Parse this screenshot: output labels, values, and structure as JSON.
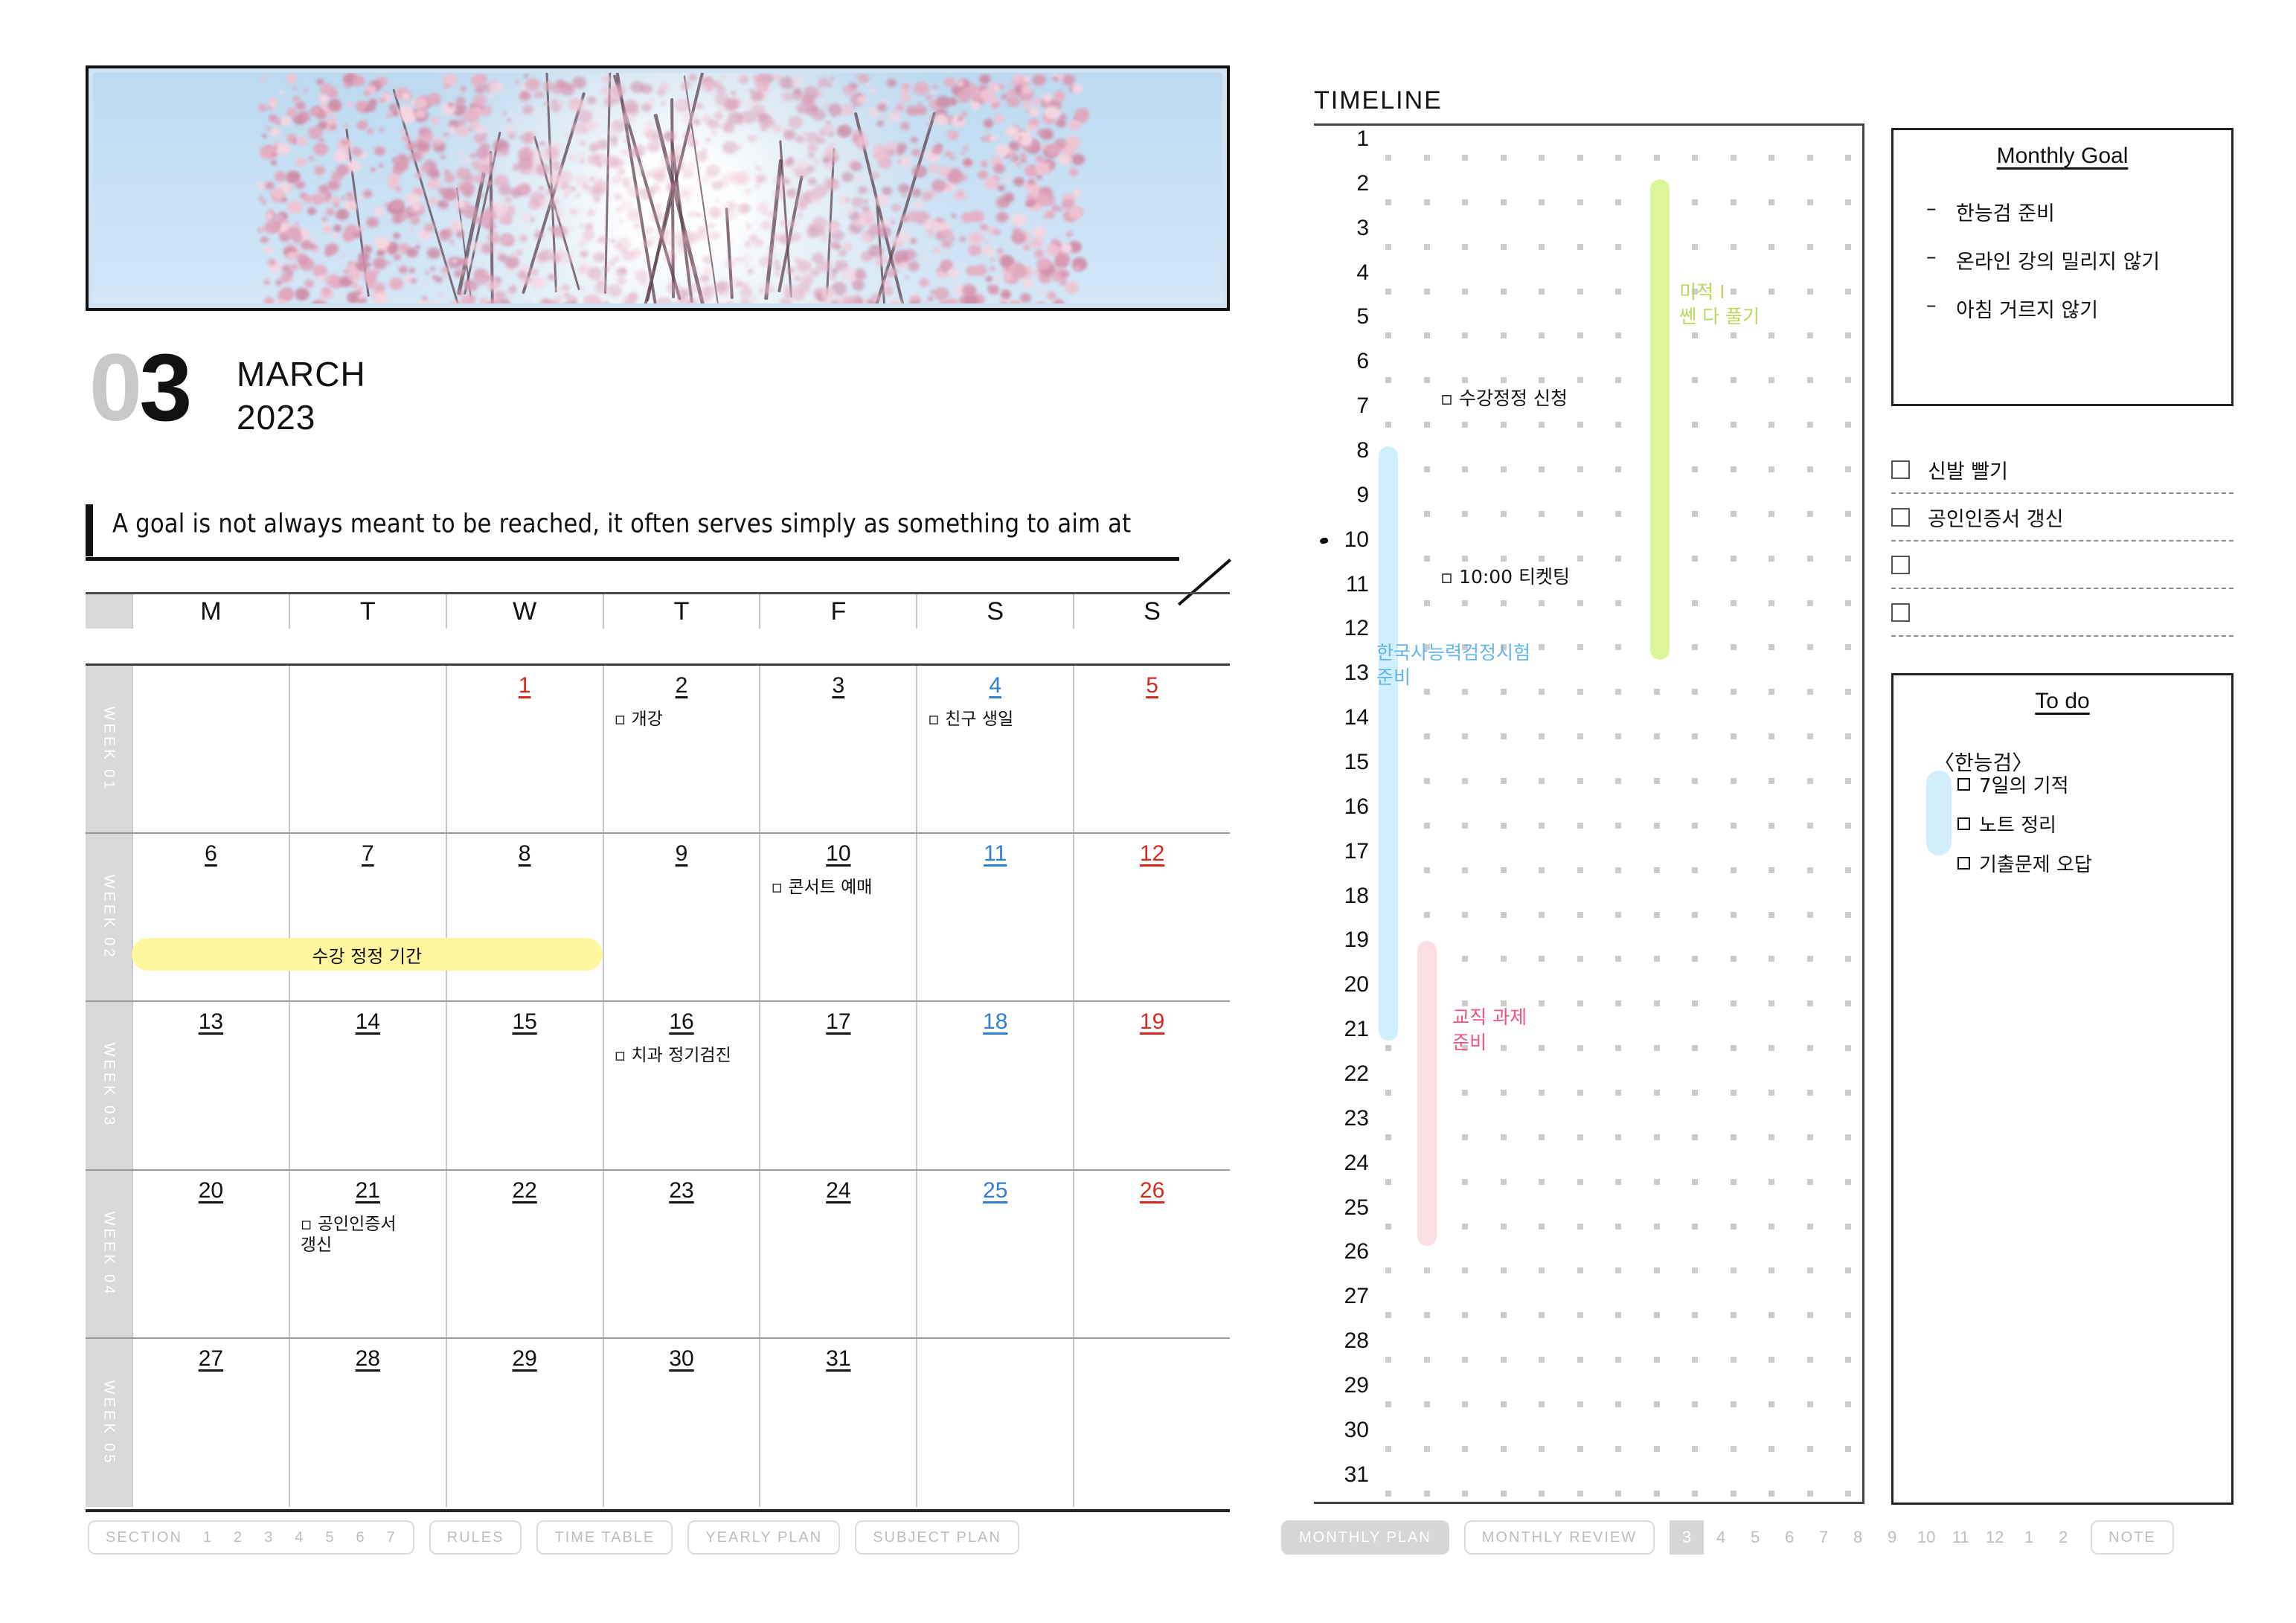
{
  "header": {
    "month_number": "03",
    "month_number_lead": "0",
    "month_number_main": "3",
    "month_name": "MARCH",
    "year": "2023",
    "photo_alt": "cherry-blossom-sunburst"
  },
  "quote": {
    "text": "A goal is not always meant to be reached, it often serves simply as something to aim at"
  },
  "calendar": {
    "dow": [
      "M",
      "T",
      "W",
      "T",
      "F",
      "S",
      "S"
    ],
    "weeks": [
      {
        "label": "WEEK 01",
        "days": [
          {
            "num": "",
            "type": "blank",
            "event": ""
          },
          {
            "num": "",
            "type": "blank",
            "event": ""
          },
          {
            "num": "1",
            "type": "sun",
            "event": ""
          },
          {
            "num": "2",
            "type": "week",
            "event": "▫ 개강"
          },
          {
            "num": "3",
            "type": "week",
            "event": ""
          },
          {
            "num": "4",
            "type": "sat",
            "event": "▫ 친구 생일"
          },
          {
            "num": "5",
            "type": "sun",
            "event": ""
          }
        ]
      },
      {
        "label": "WEEK 02",
        "days": [
          {
            "num": "6",
            "type": "week",
            "event": ""
          },
          {
            "num": "7",
            "type": "week",
            "event": ""
          },
          {
            "num": "8",
            "type": "week",
            "event": ""
          },
          {
            "num": "9",
            "type": "week",
            "event": ""
          },
          {
            "num": "10",
            "type": "week",
            "event": "▫ 콘서트 예매"
          },
          {
            "num": "11",
            "type": "sat",
            "event": ""
          },
          {
            "num": "12",
            "type": "sun",
            "event": ""
          }
        ],
        "band": {
          "text": "수강 정정 기간",
          "start_col": 0,
          "span_cols": 3,
          "color": "#fff6a0"
        }
      },
      {
        "label": "WEEK 03",
        "days": [
          {
            "num": "13",
            "type": "week",
            "event": ""
          },
          {
            "num": "14",
            "type": "week",
            "event": ""
          },
          {
            "num": "15",
            "type": "week",
            "event": ""
          },
          {
            "num": "16",
            "type": "week",
            "event": "▫ 치과 정기검진"
          },
          {
            "num": "17",
            "type": "week",
            "event": ""
          },
          {
            "num": "18",
            "type": "sat",
            "event": ""
          },
          {
            "num": "19",
            "type": "sun",
            "event": ""
          }
        ]
      },
      {
        "label": "WEEK 04",
        "days": [
          {
            "num": "20",
            "type": "week",
            "event": ""
          },
          {
            "num": "21",
            "type": "week",
            "event": "▫ 공인인증서\n   갱신"
          },
          {
            "num": "22",
            "type": "week",
            "event": ""
          },
          {
            "num": "23",
            "type": "week",
            "event": ""
          },
          {
            "num": "24",
            "type": "week",
            "event": ""
          },
          {
            "num": "25",
            "type": "sat",
            "event": ""
          },
          {
            "num": "26",
            "type": "sun",
            "event": ""
          }
        ]
      },
      {
        "label": "WEEK 05",
        "days": [
          {
            "num": "27",
            "type": "week",
            "event": ""
          },
          {
            "num": "28",
            "type": "week",
            "event": ""
          },
          {
            "num": "29",
            "type": "week",
            "event": ""
          },
          {
            "num": "30",
            "type": "week",
            "event": ""
          },
          {
            "num": "31",
            "type": "week",
            "event": ""
          },
          {
            "num": "",
            "type": "blank",
            "event": ""
          },
          {
            "num": "",
            "type": "blank",
            "event": ""
          }
        ]
      }
    ]
  },
  "timeline": {
    "title": "TIMELINE",
    "rows": [
      "1",
      "2",
      "3",
      "4",
      "5",
      "6",
      "7",
      "8",
      "9",
      "10",
      "11",
      "12",
      "13",
      "14",
      "15",
      "16",
      "17",
      "18",
      "19",
      "20",
      "21",
      "22",
      "23",
      "24",
      "25",
      "26",
      "27",
      "28",
      "29",
      "30",
      "31"
    ],
    "marked_row": "10",
    "dot_columns": 13,
    "bars": [
      {
        "label": "미적 I\n쎈 다 풀기",
        "color": "#dcf59a",
        "text_color": "#b9d95e",
        "start_row": 1.55,
        "end_row": 12.35,
        "col": 7
      },
      {
        "label": "한국사능력검정시험\n준비",
        "color": "#d0effc",
        "text_color": "#62b6ea",
        "start_row": 7.55,
        "end_row": 20.9,
        "col": 0
      },
      {
        "label": "교직 과제\n준비",
        "color": "#fcdfe5",
        "text_color": "#f0547f",
        "start_row": 18.65,
        "end_row": 25.5,
        "col": 1
      }
    ],
    "notes": [
      {
        "text": "▫ 수강정정 신청",
        "row": 5.8,
        "col": 1
      },
      {
        "text": "▫ 10:00 티켓팅",
        "row": 9.8,
        "col": 1
      }
    ]
  },
  "monthly_goal": {
    "title": "Monthly Goal",
    "items": [
      "한능검 준비",
      "온라인 강의 밀리지 않기",
      "아침 거르지 않기"
    ],
    "bullet": "–"
  },
  "checklist": {
    "items": [
      {
        "text": "신발 빨기",
        "checked": false
      },
      {
        "text": "공인인증서 갱신",
        "checked": false
      },
      {
        "text": "",
        "checked": false
      },
      {
        "text": "",
        "checked": false
      }
    ]
  },
  "todo": {
    "title": "To do",
    "group_label": "〈한능검〉",
    "items": [
      "7일의 기적",
      "노트 정리",
      "기출문제 오답"
    ],
    "accent_color": "#d3eefb"
  },
  "footer_left": {
    "section_label": "SECTION",
    "section_numbers": [
      "1",
      "2",
      "3",
      "4",
      "5",
      "6",
      "7"
    ],
    "buttons": [
      "RULES",
      "TIME TABLE",
      "YEARLY PLAN",
      "SUBJECT PLAN"
    ]
  },
  "footer_right": {
    "monthly_plan": "MONTHLY PLAN",
    "monthly_review": "MONTHLY REVIEW",
    "months": [
      "3",
      "4",
      "5",
      "6",
      "7",
      "8",
      "9",
      "10",
      "11",
      "12",
      "1",
      "2"
    ],
    "selected_month": "3",
    "note": "NOTE"
  }
}
